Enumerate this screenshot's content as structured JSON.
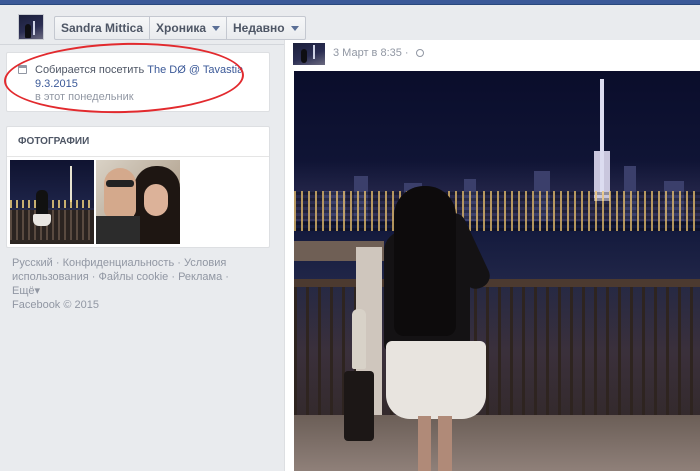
{
  "nav": {
    "profile_name": "Sandra Mittica",
    "section": "Хроника",
    "period": "Недавно"
  },
  "event": {
    "prefix": "Собирается посетить",
    "link": "The DØ @ Tavastia",
    "date": "9.3.2015",
    "relative": "в этот понедельник"
  },
  "photos": {
    "header": "ФОТОГРАФИИ"
  },
  "footer": {
    "russian": "Русский",
    "privacy": "Конфиденциальность",
    "terms": "Условия использования",
    "cookies": "Файлы cookie",
    "ads": "Реклама",
    "more": "Ещё",
    "copyright": "Facebook © 2015"
  },
  "post": {
    "timestamp": "3 Март в 8:35"
  },
  "colors": {
    "brand_blue": "#3b5998",
    "annotation_red": "#e22a2e"
  }
}
